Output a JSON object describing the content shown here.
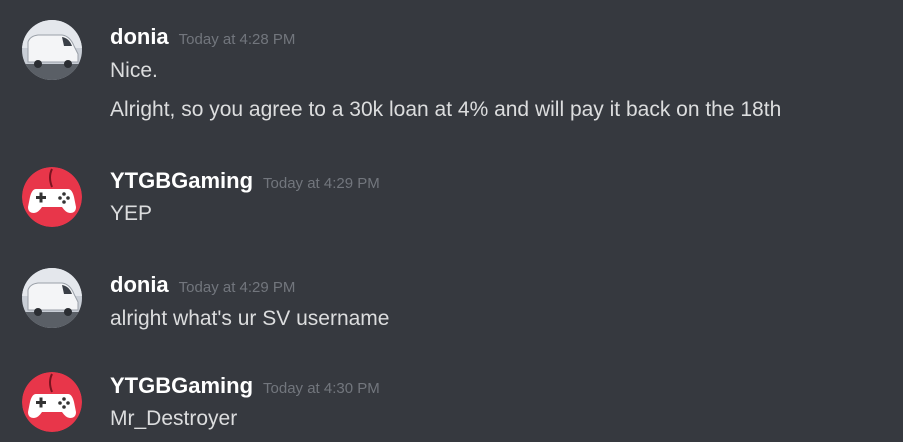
{
  "colors": {
    "background": "#36393f",
    "username": "#ffffff",
    "timestamp": "#72767d",
    "message_text": "#dcddde",
    "gamepad_avatar_bg": "#e8364a"
  },
  "messages": [
    {
      "author": "donia",
      "avatar_icon": "truck-avatar-icon",
      "timestamp": "Today at 4:28 PM",
      "lines": [
        "Nice.",
        "Alright, so you agree to a 30k loan at 4% and will pay it back on the 18th"
      ]
    },
    {
      "author": "YTGBGaming",
      "avatar_icon": "gamepad-avatar-icon",
      "timestamp": "Today at 4:29 PM",
      "lines": [
        "YEP"
      ]
    },
    {
      "author": "donia",
      "avatar_icon": "truck-avatar-icon",
      "timestamp": "Today at 4:29 PM",
      "lines": [
        "alright what's ur SV username"
      ]
    },
    {
      "author": "YTGBGaming",
      "avatar_icon": "gamepad-avatar-icon",
      "timestamp": "Today at 4:30 PM",
      "lines": [
        "Mr_Destroyer"
      ]
    }
  ]
}
